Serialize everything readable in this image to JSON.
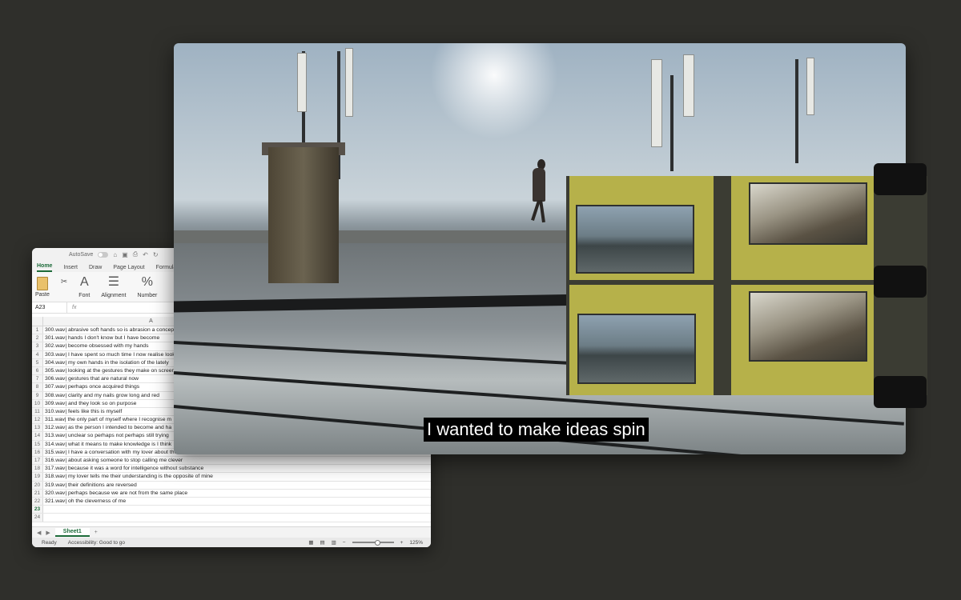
{
  "excel": {
    "autosave_label": "AutoSave",
    "tabs": [
      "Home",
      "Insert",
      "Draw",
      "Page Layout",
      "Formulas"
    ],
    "active_tab": "Home",
    "ribbon": {
      "paste": "Paste",
      "font": "Font",
      "alignment": "Alignment",
      "number": "Number"
    },
    "name_box": "A23",
    "fx_label": "fx",
    "column_a": "A",
    "rows": [
      {
        "n": "1",
        "text": "300.wav| abrasive soft hands so is abrasion a concept"
      },
      {
        "n": "2",
        "text": "301.wav| hands I don't know but I have become"
      },
      {
        "n": "3",
        "text": "302.wav| become obsessed with my hands"
      },
      {
        "n": "4",
        "text": "303.wav| I have spent so much time I now realise looking"
      },
      {
        "n": "5",
        "text": "304.wav| my own hands in the isolation of the lately"
      },
      {
        "n": "6",
        "text": "305.wav| looking at the gestures they make on screen"
      },
      {
        "n": "7",
        "text": "306.wav| gestures that are natural now"
      },
      {
        "n": "8",
        "text": "307.wav| perhaps once acquired things"
      },
      {
        "n": "9",
        "text": "308.wav| clarity and my nails grow long and red"
      },
      {
        "n": "10",
        "text": "309.wav| and they look so on purpose"
      },
      {
        "n": "11",
        "text": "310.wav| feels like this is myself"
      },
      {
        "n": "12",
        "text": "311.wav| the only part of myself where I recognise m"
      },
      {
        "n": "13",
        "text": "312.wav| as the person I intended to become and ha"
      },
      {
        "n": "14",
        "text": "313.wav| unclear so perhaps not perhaps still trying"
      },
      {
        "n": "15",
        "text": "314.wav| what it means to make knowledge is I think"
      },
      {
        "n": "16",
        "text": "315.wav| I have a conversation with my lover about the difference"
      },
      {
        "n": "17",
        "text": "316.wav| about asking someone to stop calling me clever"
      },
      {
        "n": "18",
        "text": "317.wav| because it was a word for intelligence without substance"
      },
      {
        "n": "19",
        "text": "318.wav| my lover tells me their understanding is the opposite of mine"
      },
      {
        "n": "20",
        "text": "319.wav| their definitions are reversed"
      },
      {
        "n": "21",
        "text": "320.wav| perhaps because we are not from the same place"
      },
      {
        "n": "22",
        "text": "321.wav| oh the cleverness of me"
      },
      {
        "n": "23",
        "text": ""
      },
      {
        "n": "24",
        "text": ""
      }
    ],
    "sheet_tab": "Sheet1",
    "add_sheet": "+",
    "status_ready": "Ready",
    "accessibility": "Accessibility: Good to go",
    "zoom": "125%"
  },
  "video": {
    "subtitle": "I wanted to make ideas spin"
  }
}
